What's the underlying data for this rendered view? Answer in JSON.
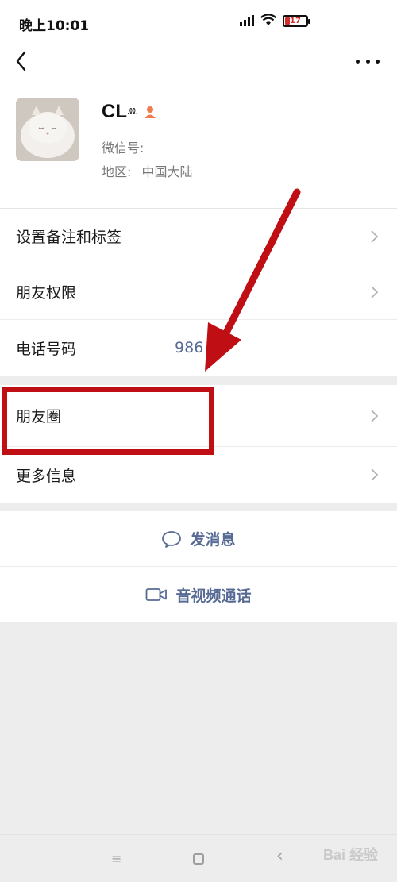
{
  "status_bar": {
    "time": "晚上10:01",
    "battery_level": "17",
    "signal": "signal-icon",
    "wifi": "wifi-icon"
  },
  "nav": {
    "back_icon": "back-chevron-icon",
    "more_icon": "more-dots-icon"
  },
  "profile": {
    "name": "CL",
    "name_deco": "ꔛ",
    "wechat_id_label": "微信号:",
    "region_label": "地区:",
    "region_value": "中国大陆",
    "gender_icon": "female-icon"
  },
  "menu": {
    "remarks_tags": "设置备注和标签",
    "friend_permissions": "朋友权限",
    "phone_label": "电话号码",
    "phone_value": "986",
    "moments": "朋友圈",
    "more_info": "更多信息"
  },
  "actions": {
    "send_message": "发消息",
    "video_call": "音视频通话"
  },
  "bottom_nav": {
    "menu_glyph": "≡",
    "back_glyph": "‹"
  },
  "watermark": "Bai 经验",
  "colors": {
    "link": "#576b95",
    "annotation": "#c00f14",
    "background": "#ededed",
    "battery_low": "#d32f2f"
  }
}
